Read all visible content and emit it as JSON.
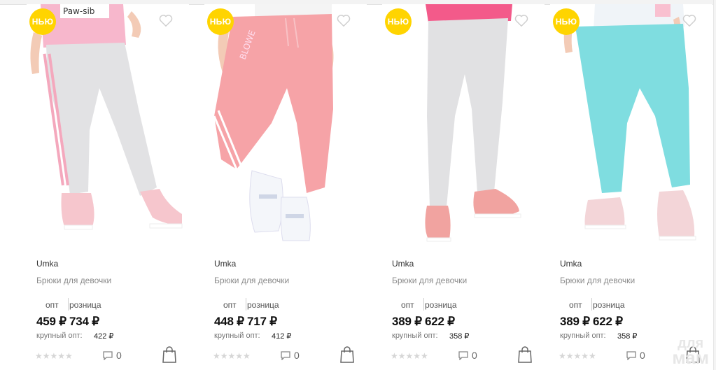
{
  "colors": {
    "badge": "#ffd400",
    "heart": "#cfcfcf",
    "text_muted": "#8a8a8a"
  },
  "products": [
    {
      "badge": "НЬЮ",
      "brand": "Umka",
      "title": "Брюки для девочки",
      "opt_label": "опт",
      "retail_label": "розница",
      "opt_price": "459 ₽",
      "retail_price": "734 ₽",
      "bulk_label": "крупный опт:",
      "bulk_price": "422 ₽",
      "stars": "★★★★★",
      "comments": "0",
      "pants_color": "#e2e2e4",
      "shirt_text": "Paw-sib"
    },
    {
      "badge": "НЬЮ",
      "brand": "Umka",
      "title": "Брюки для девочки",
      "opt_label": "опт",
      "retail_label": "розница",
      "opt_price": "448 ₽",
      "retail_price": "717 ₽",
      "bulk_label": "крупный опт:",
      "bulk_price": "412 ₽",
      "stars": "★★★★★",
      "comments": "0",
      "pants_color": "#f6a3a7",
      "leg_text": "BLOWE"
    },
    {
      "badge": "НЬЮ",
      "brand": "Umka",
      "title": "Брюки для девочки",
      "opt_label": "опт",
      "retail_label": "розница",
      "opt_price": "389 ₽",
      "retail_price": "622 ₽",
      "bulk_label": "крупный опт:",
      "bulk_price": "358 ₽",
      "stars": "★★★★★",
      "comments": "0",
      "pants_color": "#e1e1e3"
    },
    {
      "badge": "НЬЮ",
      "brand": "Umka",
      "title": "Брюки для девочки",
      "opt_label": "опт",
      "retail_label": "розница",
      "opt_price": "389 ₽",
      "retail_price": "622 ₽",
      "bulk_label": "крупный опт:",
      "bulk_price": "358 ₽",
      "stars": "★★★★★",
      "comments": "0",
      "pants_color": "#7fdde0"
    }
  ],
  "watermark": {
    "line1": "для",
    "line2": "мам"
  }
}
